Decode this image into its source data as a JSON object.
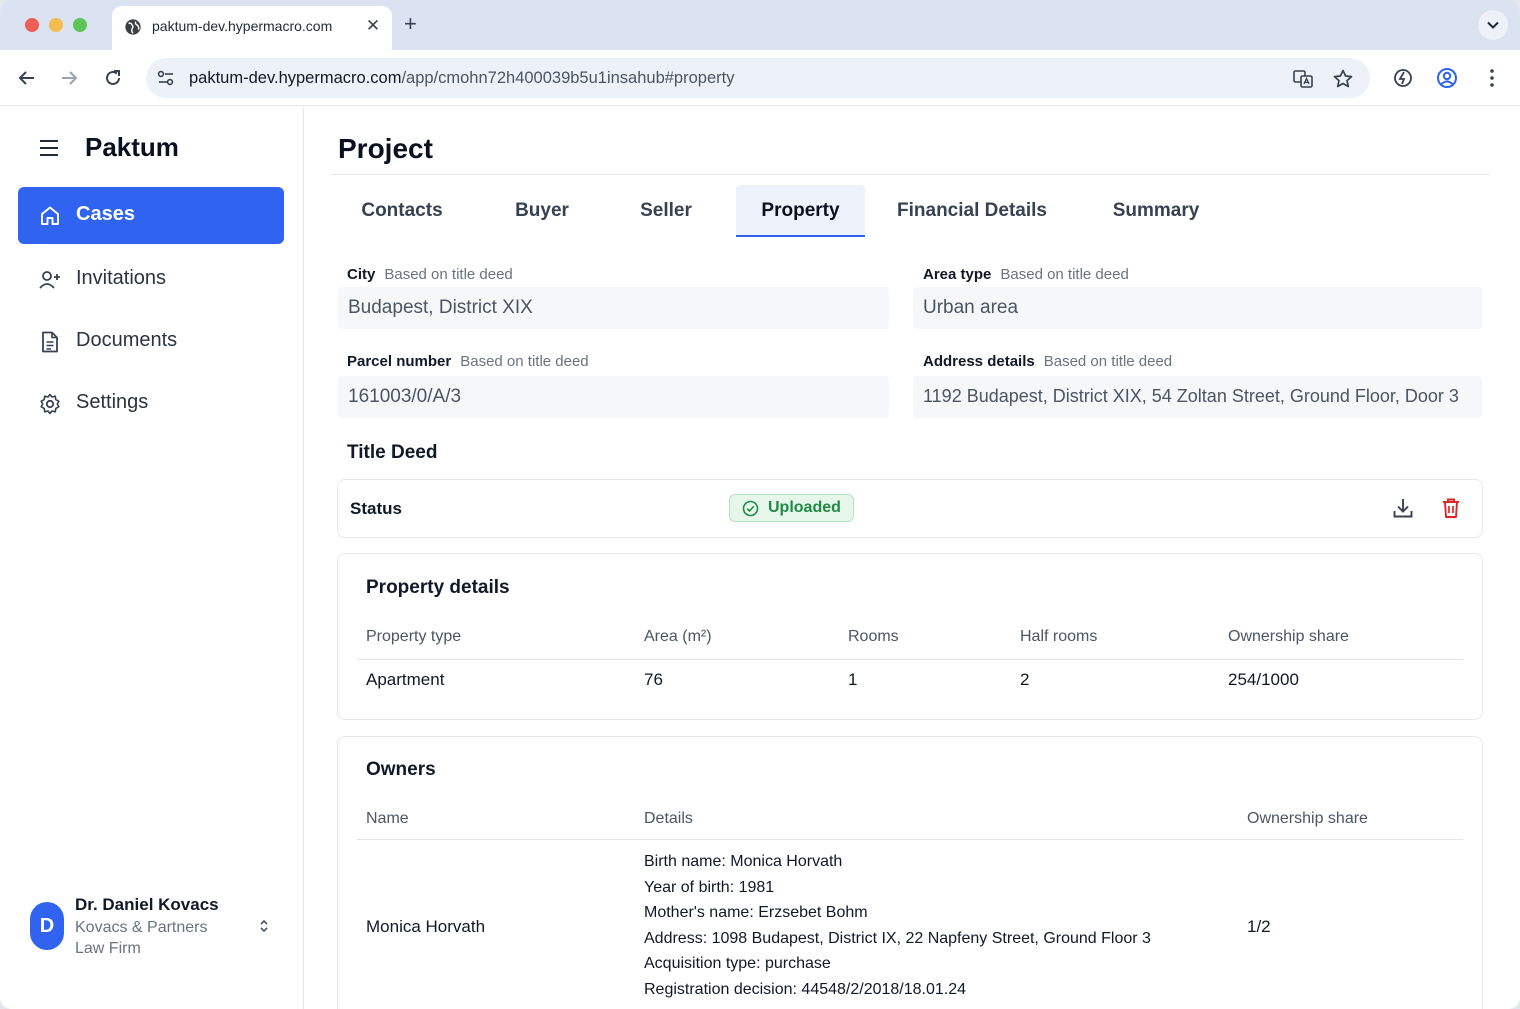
{
  "browser": {
    "tab_title": "paktum-dev.hypermacro.com",
    "url_host": "paktum-dev.hypermacro.com",
    "url_path": "/app/cmohn72h400039b5u1insahub#property"
  },
  "sidebar": {
    "app_name": "Paktum",
    "items": [
      {
        "label": "Cases",
        "icon": "home-icon",
        "active": true
      },
      {
        "label": "Invitations",
        "icon": "user-plus-icon",
        "active": false
      },
      {
        "label": "Documents",
        "icon": "document-icon",
        "active": false
      },
      {
        "label": "Settings",
        "icon": "gear-icon",
        "active": false
      }
    ],
    "user": {
      "initial": "D",
      "name": "Dr. Daniel Kovacs",
      "org": "Kovacs & Partners Law Firm"
    }
  },
  "page": {
    "title": "Project",
    "tabs": [
      "Contacts",
      "Buyer",
      "Seller",
      "Property",
      "Financial Details",
      "Summary"
    ],
    "active_tab": "Property"
  },
  "fields": {
    "city": {
      "label": "City",
      "hint": "Based on title deed",
      "value": "Budapest, District XIX"
    },
    "area_type": {
      "label": "Area type",
      "hint": "Based on title deed",
      "value": "Urban area"
    },
    "parcel_number": {
      "label": "Parcel number",
      "hint": "Based on title deed",
      "value": "161003/0/A/3"
    },
    "address_details": {
      "label": "Address details",
      "hint": "Based on title deed",
      "value": "1192 Budapest, District XIX, 54 Zoltan Street, Ground Floor, Door 3"
    }
  },
  "title_deed": {
    "heading": "Title Deed",
    "status_label": "Status",
    "status_value": "Uploaded"
  },
  "property_details": {
    "heading": "Property details",
    "columns": [
      "Property type",
      "Area (m²)",
      "Rooms",
      "Half rooms",
      "Ownership share"
    ],
    "row": [
      "Apartment",
      "76",
      "1",
      "2",
      "254/1000"
    ]
  },
  "owners": {
    "heading": "Owners",
    "columns": [
      "Name",
      "Details",
      "Ownership share"
    ],
    "rows": [
      {
        "name": "Monica Horvath",
        "details": [
          "Birth name: Monica Horvath",
          "Year of birth: 1981",
          "Mother's name: Erzsebet Bohm",
          "Address: 1098 Budapest, District IX, 22 Napfeny Street, Ground Floor 3",
          "Acquisition type: purchase",
          "Registration decision: 44548/2/2018/18.01.24"
        ],
        "share": "1/2"
      }
    ]
  },
  "colors": {
    "accent": "#2f63f0",
    "success": "#1f8a44",
    "danger": "#dc2626"
  }
}
